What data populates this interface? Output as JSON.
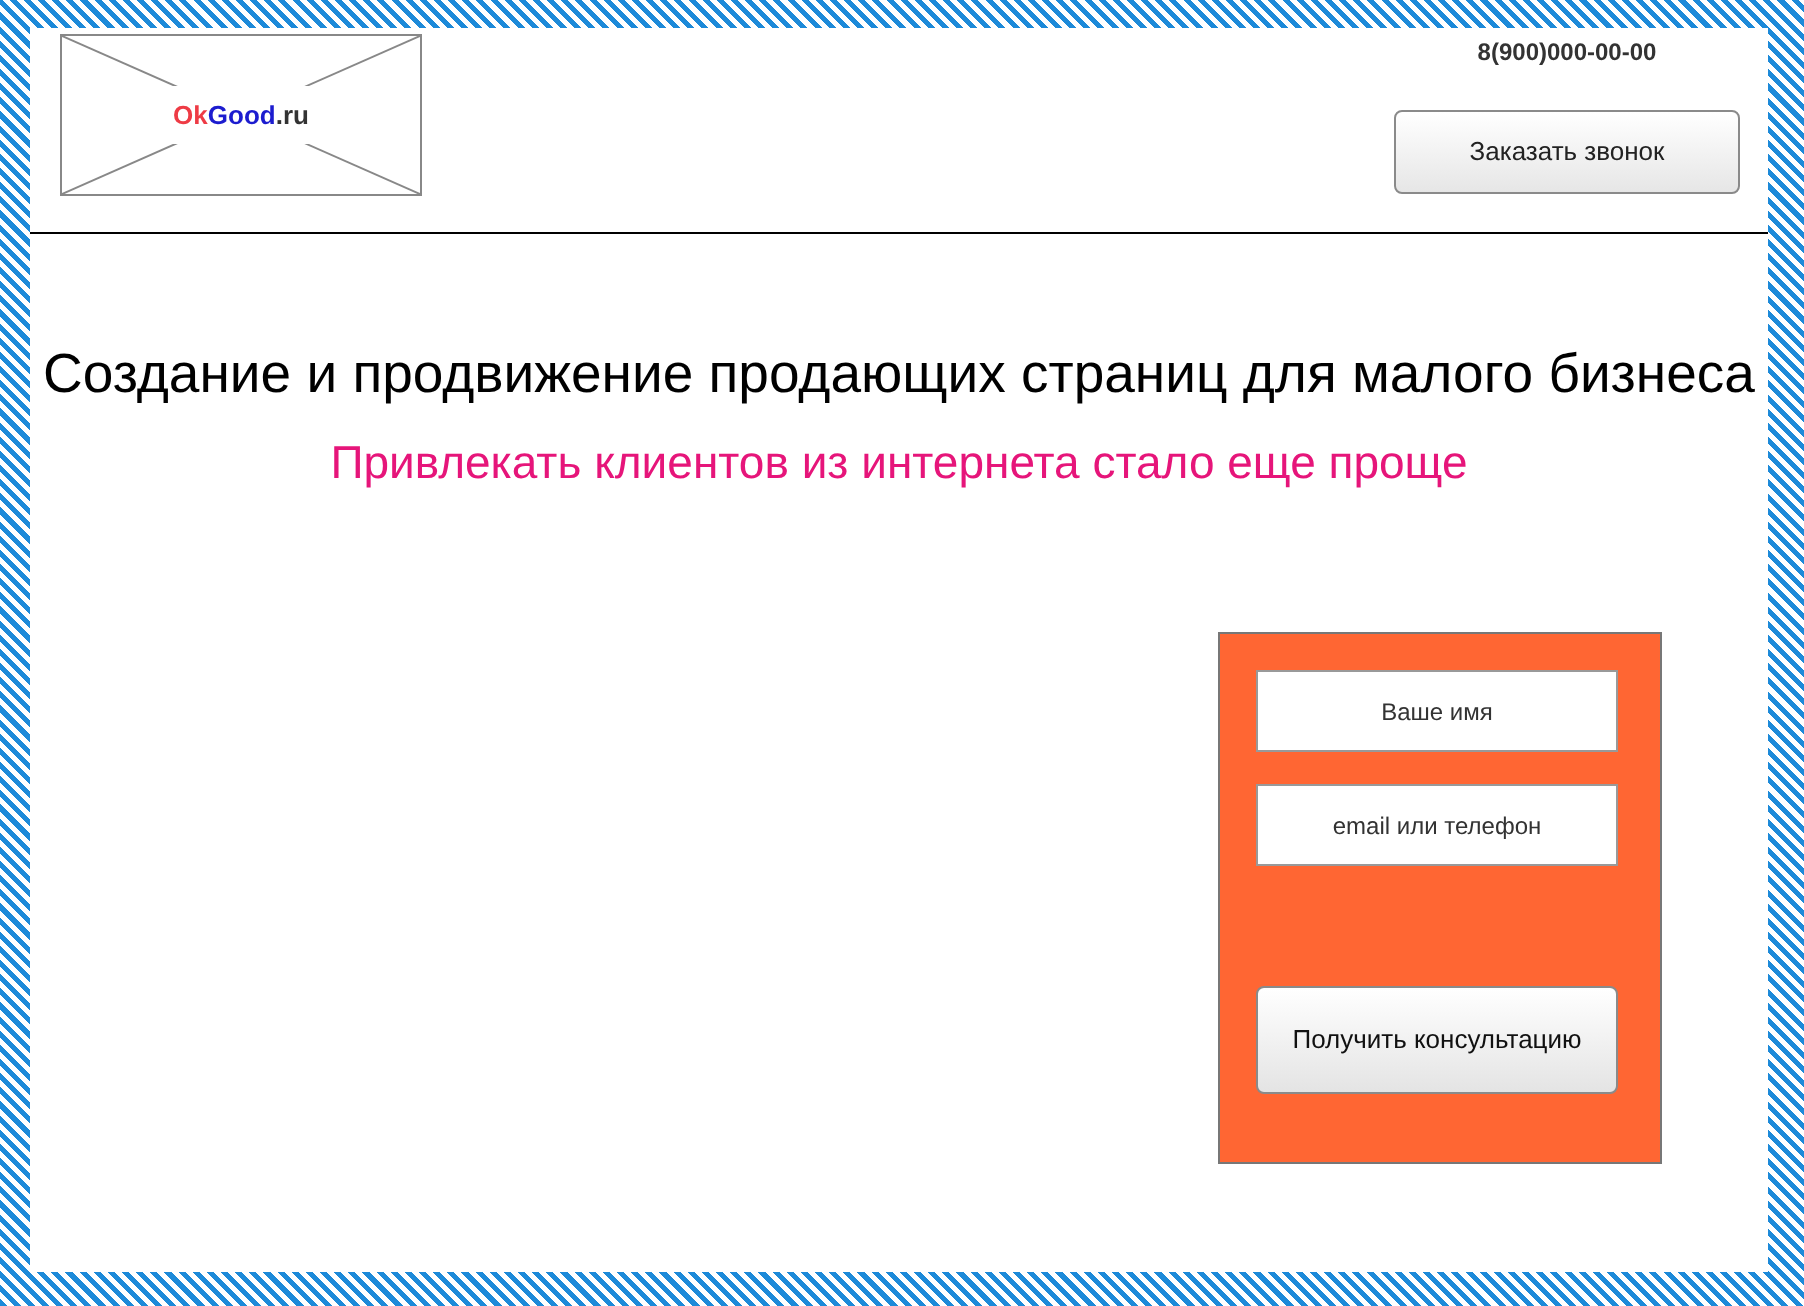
{
  "logo": {
    "parts": [
      {
        "text": "Ok",
        "color": "#ee3b45"
      },
      {
        "text": "Good",
        "color": "#1c1ccf"
      },
      {
        "text": ".ru",
        "color": "#333333"
      }
    ]
  },
  "header": {
    "phone": "8(900)000-00-00",
    "callback_button": "Заказать звонок"
  },
  "hero": {
    "title": "Создание и продвижение продающих страниц для малого бизнеса",
    "subtitle": "Привлекать клиентов из интернета стало еще проще"
  },
  "form": {
    "fields": [
      {
        "placeholder": "Ваше имя"
      },
      {
        "placeholder": "email или телефон"
      }
    ],
    "submit_button": "Получить консультацию"
  }
}
